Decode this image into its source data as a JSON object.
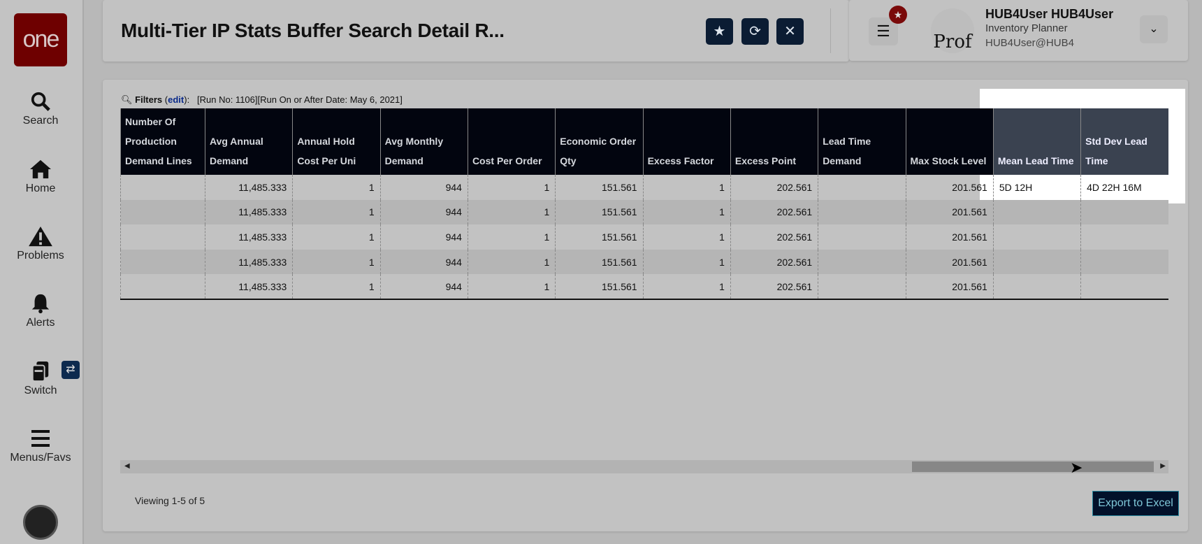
{
  "app": {
    "logo": "one"
  },
  "sidebar": {
    "items": [
      {
        "label": "Search",
        "icon": "search-icon"
      },
      {
        "label": "Home",
        "icon": "home-icon"
      },
      {
        "label": "Problems",
        "icon": "warning-icon"
      },
      {
        "label": "Alerts",
        "icon": "bell-icon"
      },
      {
        "label": "Switch",
        "icon": "switch-icon"
      },
      {
        "label": "Menus/Favs",
        "icon": "menu-icon"
      }
    ]
  },
  "header": {
    "title": "Multi-Tier IP Stats Buffer Search Detail R...",
    "user": {
      "name": "HUB4User HUB4User",
      "role": "Inventory Planner",
      "email": "HUB4User@HUB4",
      "avatar_text": "Prof"
    }
  },
  "filters": {
    "label": "Filters",
    "edit": "edit",
    "text": "[Run No: 1106][Run On or After Date: May 6, 2021]"
  },
  "table": {
    "columns": [
      "Number Of Production Demand Lines",
      "Avg Annual Demand",
      "Annual Hold Cost Per Uni",
      "Avg Monthly Demand",
      "Cost Per Order",
      "Economic Order Qty",
      "Excess Factor",
      "Excess Point",
      "Lead Time Demand",
      "Max Stock Level",
      "Mean Lead Time",
      "Std Dev Lead Time"
    ],
    "rows": [
      [
        "",
        "11,485.333",
        "1",
        "944",
        "1",
        "151.561",
        "1",
        "202.561",
        "",
        "201.561",
        "5D 12H",
        "4D 22H 16M"
      ],
      [
        "",
        "11,485.333",
        "1",
        "944",
        "1",
        "151.561",
        "1",
        "202.561",
        "",
        "201.561",
        "",
        ""
      ],
      [
        "",
        "11,485.333",
        "1",
        "944",
        "1",
        "151.561",
        "1",
        "202.561",
        "",
        "201.561",
        "",
        ""
      ],
      [
        "",
        "11,485.333",
        "1",
        "944",
        "1",
        "151.561",
        "1",
        "202.561",
        "",
        "201.561",
        "",
        ""
      ],
      [
        "",
        "11,485.333",
        "1",
        "944",
        "1",
        "151.561",
        "1",
        "202.561",
        "",
        "201.561",
        "",
        ""
      ]
    ]
  },
  "footer": {
    "viewing": "Viewing 1-5 of 5",
    "export": "Export to Excel"
  },
  "colors": {
    "brand": "#6e0000",
    "header_bg": "#02050f",
    "button": "#0b1c33"
  }
}
